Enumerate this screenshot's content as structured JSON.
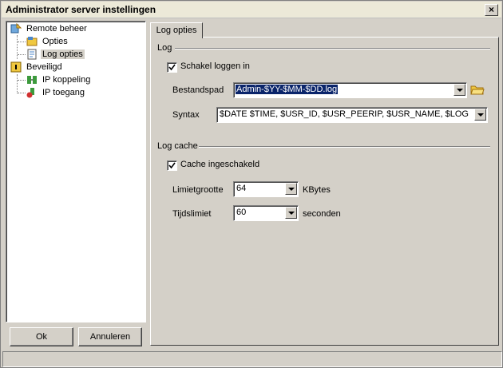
{
  "window": {
    "title": "Administrator server instellingen",
    "close_glyph": "×"
  },
  "tree": {
    "items": [
      {
        "label": "Remote beheer",
        "icon": "remote-admin-icon"
      },
      {
        "label": "Opties",
        "icon": "options-icon"
      },
      {
        "label": "Log opties",
        "icon": "log-options-icon",
        "selected": true
      },
      {
        "label": "Beveiligd",
        "icon": "security-lock-icon"
      },
      {
        "label": "IP koppeling",
        "icon": "ip-binding-icon"
      },
      {
        "label": "IP toegang",
        "icon": "ip-access-icon"
      }
    ]
  },
  "buttons": {
    "ok": "Ok",
    "cancel": "Annuleren"
  },
  "tab": {
    "label": "Log opties"
  },
  "log": {
    "heading": "Log",
    "enable_label": "Schakel loggen in",
    "enable_checked": true,
    "path_label": "Bestandspad",
    "path_value": "Admin-$YY-$MM-$DD.log",
    "syntax_label": "Syntax",
    "syntax_value": "$DATE $TIME, $USR_ID, $USR_PEERIP, $USR_NAME, $LOG"
  },
  "cache": {
    "heading": "Log cache",
    "enable_label": "Cache ingeschakeld",
    "enable_checked": true,
    "size_label": "Limietgrootte",
    "size_value": "64",
    "size_unit": "KBytes",
    "time_label": "Tijdslimiet",
    "time_value": "60",
    "time_unit": "seconden"
  },
  "colors": {
    "face": "#d4d0c8",
    "selection": "#0a246a",
    "folder": "#f0c840"
  }
}
